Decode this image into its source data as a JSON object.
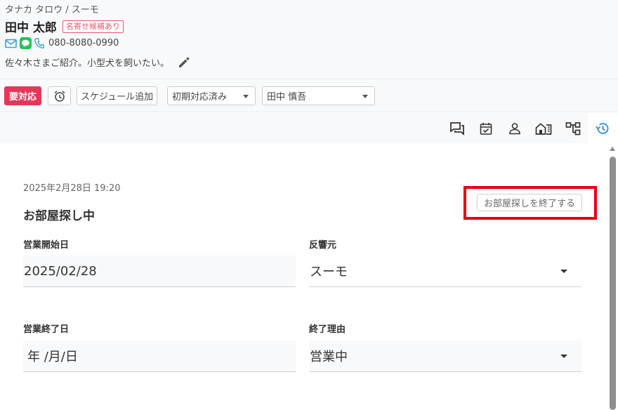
{
  "customer": {
    "kana": "タナカ タロウ / スーモ",
    "name": "田中 太郎",
    "tag": "名寄せ候補あり",
    "phone": "080-8080-0990",
    "note": "佐々木さまご紹介。小型犬を飼いたい。"
  },
  "toolbar": {
    "urgent_label": "要対応",
    "schedule_label": "スケジュール追加",
    "status_value": "初期対応済み",
    "staff_value": "田中 慎吾"
  },
  "tabs": [
    {
      "icon": "chat-icon"
    },
    {
      "icon": "calendar-check-icon"
    },
    {
      "icon": "person-icon"
    },
    {
      "icon": "building-icon"
    },
    {
      "icon": "hierarchy-icon"
    },
    {
      "icon": "history-icon",
      "active": true
    }
  ],
  "detail": {
    "date": "2025年2月28日 19:20",
    "title": "お部屋探し中",
    "end_button_label": "お部屋探しを終了する",
    "fields": {
      "start_date_label": "営業開始日",
      "start_date_value": "2025/02/28",
      "source_label": "反響元",
      "source_value": "スーモ",
      "end_date_label": "営業終了日",
      "end_date_value": "年 /月/日",
      "end_reason_label": "終了理由",
      "end_reason_value": "営業中"
    }
  },
  "colors": {
    "urgent": "#e5375a",
    "tag": "#e9546b",
    "highlight": "#e60012",
    "active_tab": "#3a9ad9",
    "mail": "#3aa3c8",
    "line": "#26c05a"
  }
}
